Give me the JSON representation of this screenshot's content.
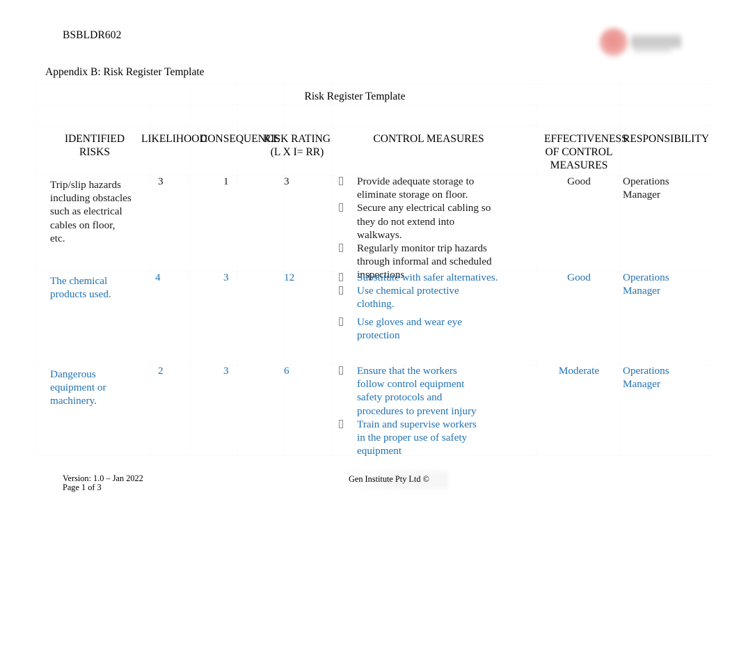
{
  "header": {
    "doc_code": "BSBLDR602",
    "appendix_title": "Appendix B: Risk Register Template",
    "logo_alt": "blurred-institute-logo"
  },
  "table": {
    "title": "Risk Register Template",
    "columns": [
      {
        "key": "identified_risks",
        "label": "IDENTIFIED RISKS"
      },
      {
        "key": "likelihood",
        "label": "LIKELIHOOD"
      },
      {
        "key": "consequence",
        "label": "CONSEQUENCE"
      },
      {
        "key": "risk_rating",
        "label": "RISK RATING",
        "sublabel": "(L  X I= RR)"
      },
      {
        "key": "control_measures",
        "label": "CONTROL MEASURES"
      },
      {
        "key": "effectiveness",
        "label": "EFFECTIVENESS OF CONTROL MEASURES"
      },
      {
        "key": "responsibility",
        "label": "RESPONSIBILITY"
      }
    ],
    "rows": [
      {
        "identified_risks": "Trip/slip hazards including obstacles such as electrical cables on floor, etc.",
        "likelihood": "3",
        "consequence": "1",
        "risk_rating": "3",
        "control_measures": [
          "Provide adequate storage to eliminate storage on floor.",
          "Secure any electrical cabling so they do not extend into walkways.",
          "Regularly monitor trip hazards through informal and scheduled inspections."
        ],
        "effectiveness": "Good",
        "responsibility": "Operations Manager",
        "color": "black"
      },
      {
        "identified_risks": "The chemical products used.",
        "likelihood": "4",
        "consequence": "3",
        "risk_rating": "12",
        "control_measures": [
          "Substitute with safer alternatives.",
          "Use chemical protective clothing.",
          "Use gloves and wear eye protection"
        ],
        "effectiveness": "Good",
        "responsibility": "Operations Manager",
        "color": "blue"
      },
      {
        "identified_risks": "Dangerous equipment or machinery.",
        "likelihood": "2",
        "consequence": "3",
        "risk_rating": "6",
        "control_measures": [
          "Ensure that the workers follow control equipment safety protocols and procedures to prevent injury",
          "Train and supervise workers in the proper use of safety equipment"
        ],
        "effectiveness": "Moderate",
        "responsibility": "Operations Manager",
        "color": "blue"
      }
    ]
  },
  "footer": {
    "version": "Version: 1.0 – Jan 2022",
    "page": "Page   1  of 3",
    "copyright": "Gen Institute Pty Ltd ©"
  },
  "colors": {
    "blue_text": "#2272b4",
    "black_text": "#1a1a1a",
    "page_background": "#ffffff",
    "logo_red": "#e2635f"
  }
}
